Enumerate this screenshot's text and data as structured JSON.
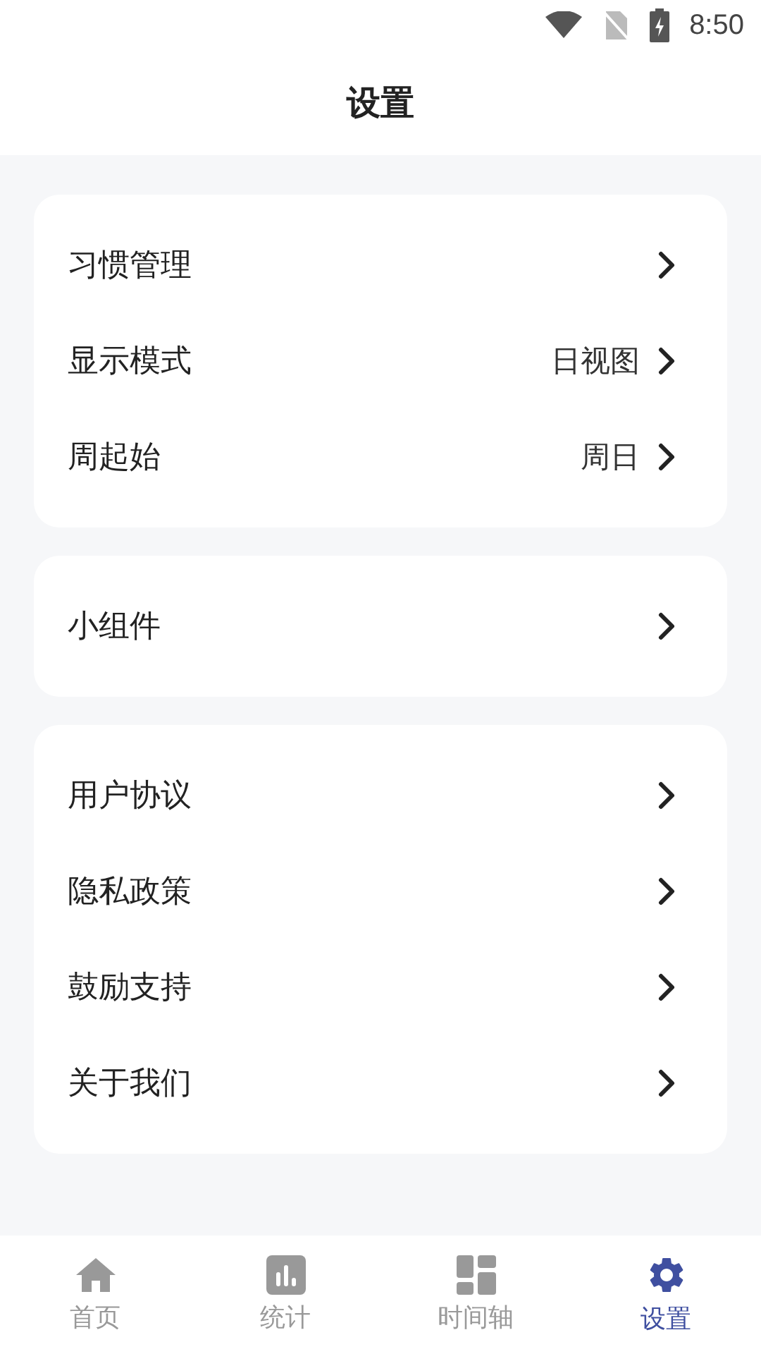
{
  "status_bar": {
    "time": "8:50"
  },
  "header": {
    "title": "设置"
  },
  "groups": [
    {
      "items": [
        {
          "label": "习惯管理"
        },
        {
          "label": "显示模式",
          "value": "日视图"
        },
        {
          "label": "周起始",
          "value": "周日"
        }
      ]
    },
    {
      "items": [
        {
          "label": "小组件"
        }
      ]
    },
    {
      "items": [
        {
          "label": "用户协议"
        },
        {
          "label": "隐私政策"
        },
        {
          "label": "鼓励支持"
        },
        {
          "label": "关于我们"
        }
      ]
    }
  ],
  "tab_bar": [
    {
      "kind": "home",
      "label": "首页",
      "selected": false
    },
    {
      "kind": "stats",
      "label": "统计",
      "selected": false
    },
    {
      "kind": "timeline",
      "label": "时间轴",
      "selected": false
    },
    {
      "kind": "settings",
      "label": "设置",
      "selected": true
    }
  ]
}
